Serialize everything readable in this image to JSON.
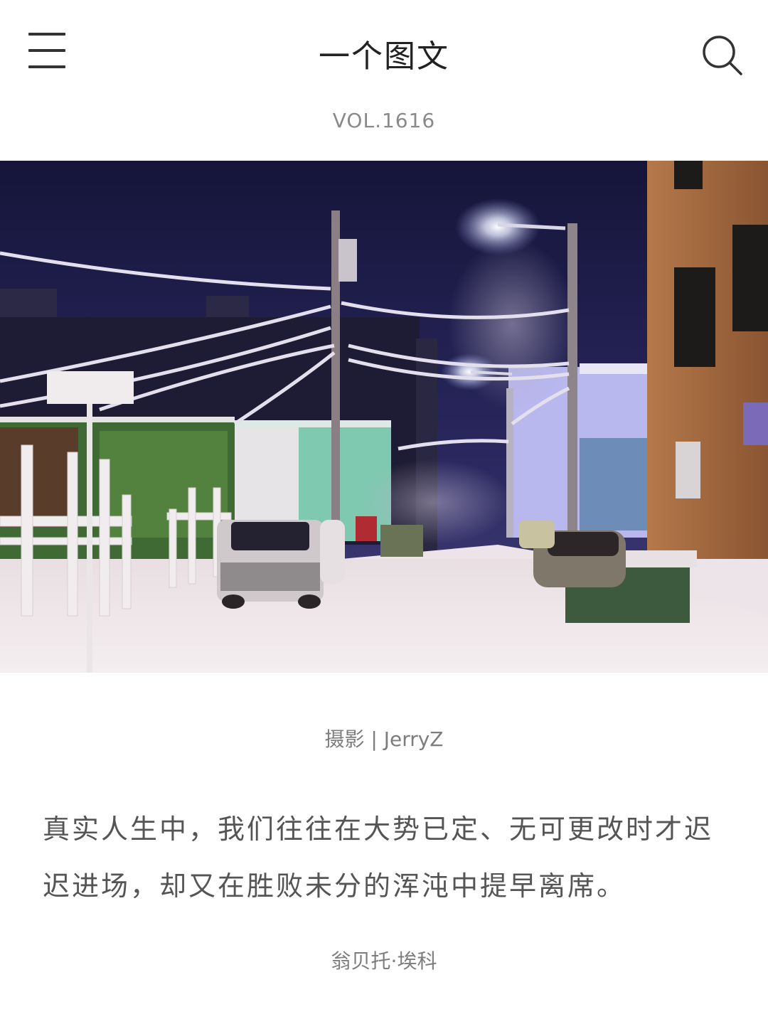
{
  "header": {
    "title": "一个图文",
    "menu_icon": "hamburger-menu-icon",
    "search_icon": "search-icon"
  },
  "vol": "VOL.1616",
  "photo": {
    "description_icon": "snowy-alley-night-photo"
  },
  "credit": "摄影 | JerryZ",
  "quote": "真实人生中，我们往往在大势已定、无可更改时才迟迟进场，却又在胜败未分的浑沌中提早离席。",
  "author": "翁贝托·埃科"
}
